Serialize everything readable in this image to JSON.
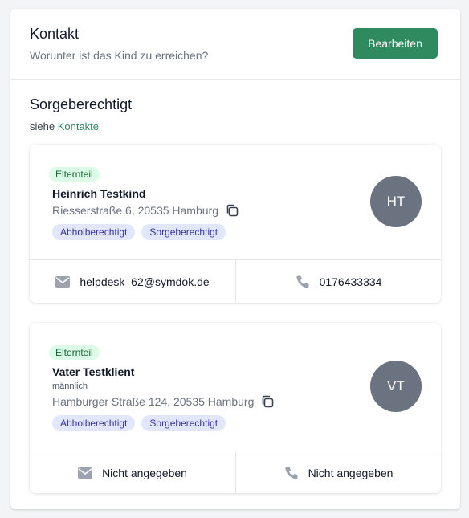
{
  "header": {
    "title": "Kontakt",
    "subtitle": "Worunter ist das Kind zu erreichen?",
    "edit_label": "Bearbeiten"
  },
  "section": {
    "title": "Sorgeberechtigt",
    "ref_prefix": "siehe",
    "ref_link": "Kontakte"
  },
  "contacts": [
    {
      "role": "Elternteil",
      "name": "Heinrich Testkind",
      "address": "Riesserstraße 6, 20535 Hamburg",
      "tags": [
        "Abholberechtigt",
        "Sorgeberechtigt"
      ],
      "initials": "HT",
      "email": "helpdesk_62@symdok.de",
      "phone": "0176433334"
    },
    {
      "role": "Elternteil",
      "name": "Vater Testklient",
      "gender": "männlich",
      "address": "Hamburger Straße 124, 20535 Hamburg",
      "tags": [
        "Abholberechtigt",
        "Sorgeberechtigt"
      ],
      "initials": "VT",
      "email": "Nicht angegeben",
      "phone": "Nicht angegeben"
    }
  ],
  "colors": {
    "accent": "#2f8a5f",
    "badge_bg": "#dcfce7",
    "tag_bg": "#e0e7ff",
    "avatar_bg": "#6b7280"
  }
}
